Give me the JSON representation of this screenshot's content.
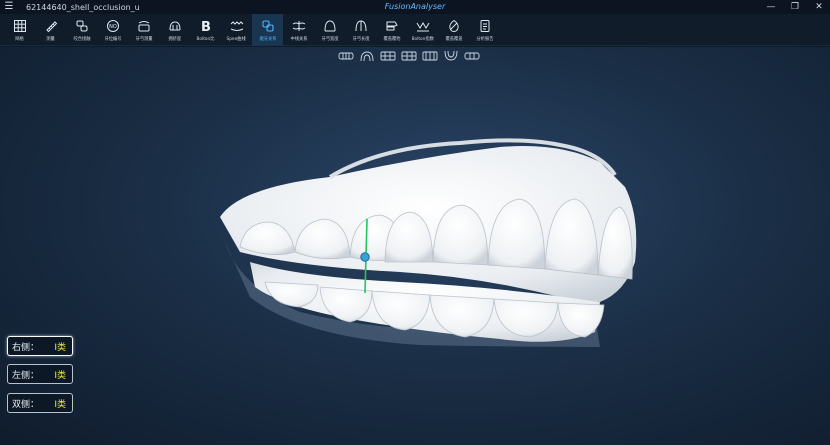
{
  "titlebar": {
    "filename": "62144640_shell_occlusion_u",
    "app_name": "FusionAnalyser"
  },
  "toolbar": {
    "items": [
      {
        "label": "网格",
        "icon": "grid-icon"
      },
      {
        "label": "测量",
        "icon": "ruler-icon"
      },
      {
        "label": "咬合接触",
        "icon": "occlusion-contact-icon"
      },
      {
        "label": "牙位编号",
        "icon": "tooth-number-icon"
      },
      {
        "label": "牙弓测量",
        "icon": "arch-measure-icon"
      },
      {
        "label": "拥挤度",
        "icon": "crowding-icon"
      },
      {
        "label": "Bolton比",
        "icon": "bolton-icon"
      },
      {
        "label": "Spee曲线",
        "icon": "spee-curve-icon"
      },
      {
        "label": "磨牙关系",
        "icon": "molar-relation-icon"
      },
      {
        "label": "中线关系",
        "icon": "midline-icon"
      },
      {
        "label": "牙弓宽度",
        "icon": "arch-width-icon"
      },
      {
        "label": "牙弓长度",
        "icon": "arch-length-icon"
      },
      {
        "label": "覆盖覆殆",
        "icon": "overjet-icon"
      },
      {
        "label": "Bolton指数",
        "icon": "bolton-index-icon"
      },
      {
        "label": "覆盖覆盖",
        "icon": "overbite-icon"
      },
      {
        "label": "分析报告",
        "icon": "report-icon"
      }
    ],
    "active_index": 8
  },
  "view_buttons": [
    {
      "icon": "view-front-icon"
    },
    {
      "icon": "view-upper-occlusal-icon"
    },
    {
      "icon": "view-right-icon"
    },
    {
      "icon": "view-left-icon"
    },
    {
      "icon": "view-back-icon"
    },
    {
      "icon": "view-lower-occlusal-icon"
    },
    {
      "icon": "view-bottom-icon"
    }
  ],
  "classification": [
    {
      "label": "右侧：",
      "value": "I类"
    },
    {
      "label": "左侧：",
      "value": "I类"
    },
    {
      "label": "双侧：",
      "value": "I类"
    }
  ],
  "colors": {
    "accent": "#4fb3ff",
    "marker": "#22c55e",
    "class_value": "#e8e64a"
  }
}
